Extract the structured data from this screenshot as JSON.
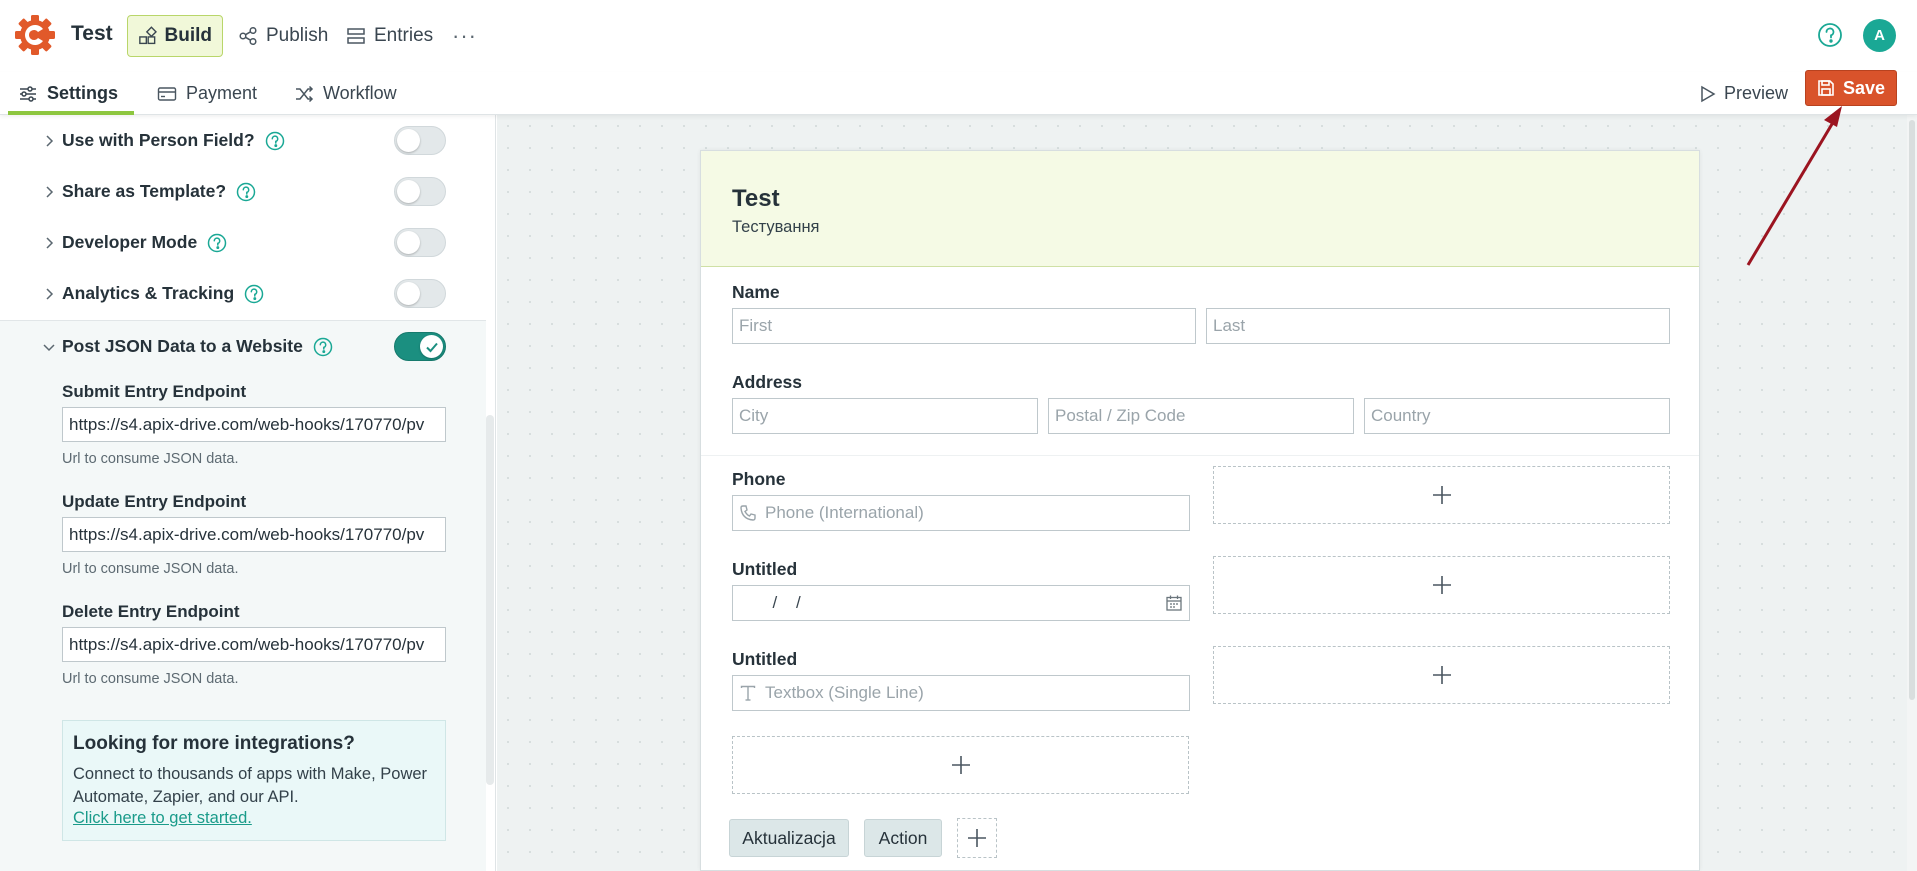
{
  "app": {
    "title": "Test",
    "avatar_initial": "A",
    "accent": "#d9532b",
    "brand_green": "#8dc63f",
    "teal": "#1b8f80"
  },
  "nav": {
    "build": "Build",
    "publish": "Publish",
    "entries": "Entries",
    "more": "···"
  },
  "subnav": {
    "settings": "Settings",
    "payment": "Payment",
    "workflow": "Workflow",
    "preview": "Preview",
    "save": "Save"
  },
  "sidebar": {
    "settings": [
      {
        "label": "Use with Person Field?",
        "enabled": false
      },
      {
        "label": "Share as Template?",
        "enabled": false
      },
      {
        "label": "Developer Mode",
        "enabled": false
      },
      {
        "label": "Analytics & Tracking",
        "enabled": false
      },
      {
        "label": "Post JSON Data to a Website",
        "enabled": true
      }
    ],
    "endpoints": [
      {
        "label": "Submit Entry Endpoint",
        "value": "https://s4.apix-drive.com/web-hooks/170770/pv",
        "hint": "Url to consume JSON data."
      },
      {
        "label": "Update Entry Endpoint",
        "value": "https://s4.apix-drive.com/web-hooks/170770/pv",
        "hint": "Url to consume JSON data."
      },
      {
        "label": "Delete Entry Endpoint",
        "value": "https://s4.apix-drive.com/web-hooks/170770/pv",
        "hint": "Url to consume JSON data."
      }
    ],
    "integrations": {
      "title": "Looking for more integrations?",
      "text": "Connect to thousands of apps with Make, Power Automate, Zapier, and our API.",
      "link": "Click here to get started."
    }
  },
  "form": {
    "title": "Test",
    "description": "Тестування",
    "name": {
      "label": "Name",
      "first": "First",
      "last": "Last"
    },
    "address": {
      "label": "Address",
      "city": "City",
      "postal": "Postal / Zip Code",
      "country": "Country"
    },
    "phone": {
      "label": "Phone",
      "placeholder": "Phone (International)"
    },
    "date": {
      "label": "Untitled",
      "placeholder": "  /    /"
    },
    "textbox": {
      "label": "Untitled",
      "placeholder": "Textbox (Single Line)"
    },
    "buttons": [
      "Aktualizacja",
      "Action"
    ]
  }
}
